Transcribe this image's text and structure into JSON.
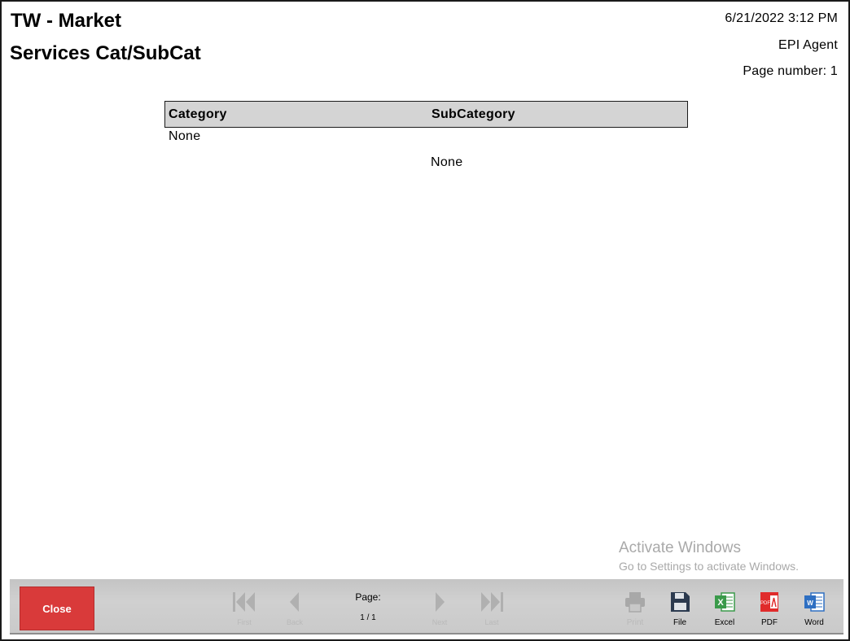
{
  "header": {
    "title_line1": "TW - Market",
    "title_line2": "Services Cat/SubCat",
    "datetime": "6/21/2022 3:12 PM",
    "user": "EPI Agent",
    "page_number": "Page number: 1"
  },
  "table": {
    "columns": [
      "Category",
      "SubCategory"
    ],
    "rows": [
      {
        "category": "None",
        "subcategory": ""
      },
      {
        "category": "",
        "subcategory": "None"
      }
    ]
  },
  "watermark": {
    "line1": "Activate Windows",
    "line2": "Go to Settings to activate Windows."
  },
  "toolbar": {
    "close_label": "Close",
    "nav": {
      "first": "First",
      "back": "Back",
      "next": "Next",
      "last": "Last"
    },
    "page_label": "Page:",
    "page_value": "1 / 1",
    "actions": {
      "print": "Print",
      "file": "File",
      "excel": "Excel",
      "pdf": "PDF",
      "word": "Word"
    }
  },
  "colors": {
    "close_button": "#d93a3a",
    "excel": "#3a9a4a",
    "pdf": "#e02b2b",
    "word": "#2e6fc2",
    "file": "#2b3a4f",
    "disabled": "#b0b0b0"
  }
}
